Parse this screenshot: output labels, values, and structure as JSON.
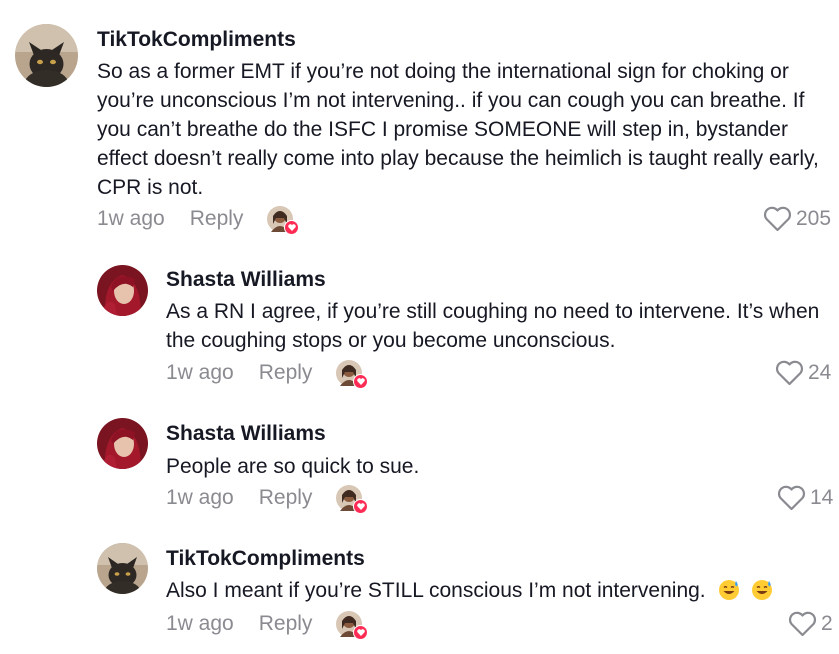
{
  "comments": [
    {
      "author": "TikTokCompliments",
      "text": "So as a former EMT if you’re not doing the international sign for choking or you’re unconscious I’m not intervening.. if you can cough you can breathe. If you can’t breathe do the ISFC I promise SOMEONE will step in, bystander effect doesn’t really come into play because the heimlich is taught really early, CPR is not.",
      "time": "1w ago",
      "reply_label": "Reply",
      "likes": "205",
      "avatar": "cat-avatar"
    },
    {
      "author": "Shasta Williams",
      "text": "As a RN I agree, if you’re still coughing no need to intervene. It’s when the coughing stops or you become unconscious.",
      "time": "1w ago",
      "reply_label": "Reply",
      "likes": "24",
      "avatar": "woman-avatar"
    },
    {
      "author": "Shasta Williams",
      "text": "People are so quick to sue.",
      "time": "1w ago",
      "reply_label": "Reply",
      "likes": "14",
      "avatar": "woman-avatar"
    },
    {
      "author": "TikTokCompliments",
      "text": "Also I meant if you’re STILL conscious I’m not intervening.",
      "time": "1w ago",
      "reply_label": "Reply",
      "likes": "2",
      "avatar": "cat-avatar",
      "emojis": [
        "sweat-smile-emoji",
        "sweat-smile-emoji"
      ]
    }
  ],
  "colors": {
    "text": "#161823",
    "muted": "#8a8b91",
    "creator_heart": "#fe2c55"
  }
}
